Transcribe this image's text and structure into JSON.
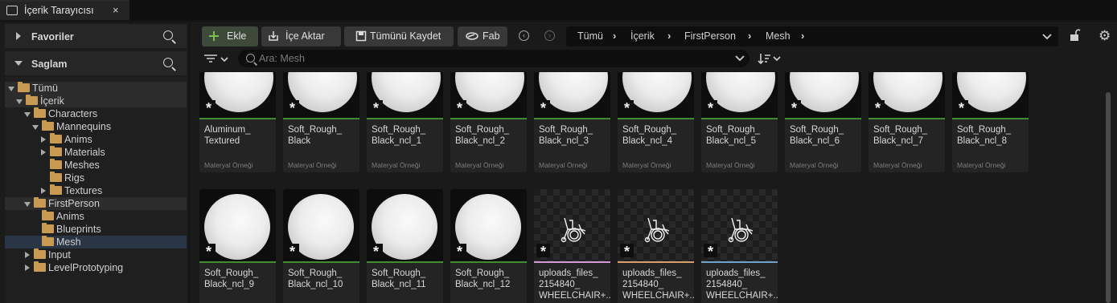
{
  "tab": {
    "title": "İçerik Tarayıcısı",
    "close": "×"
  },
  "left": {
    "favorites": "Favoriler",
    "source": "Saglam",
    "tree": [
      {
        "label": "Tümü",
        "depth": 0,
        "arrow": "open",
        "state": "hl"
      },
      {
        "label": "İçerik",
        "depth": 1,
        "arrow": "open",
        "state": "hl"
      },
      {
        "label": "Characters",
        "depth": 2,
        "arrow": "open",
        "state": ""
      },
      {
        "label": "Mannequins",
        "depth": 3,
        "arrow": "open",
        "state": ""
      },
      {
        "label": "Anims",
        "depth": 4,
        "arrow": "closed",
        "state": ""
      },
      {
        "label": "Materials",
        "depth": 4,
        "arrow": "closed",
        "state": ""
      },
      {
        "label": "Meshes",
        "depth": 4,
        "arrow": "none",
        "state": ""
      },
      {
        "label": "Rigs",
        "depth": 4,
        "arrow": "none",
        "state": ""
      },
      {
        "label": "Textures",
        "depth": 4,
        "arrow": "closed",
        "state": ""
      },
      {
        "label": "FirstPerson",
        "depth": 2,
        "arrow": "open",
        "state": "hl"
      },
      {
        "label": "Anims",
        "depth": 3,
        "arrow": "none",
        "state": ""
      },
      {
        "label": "Blueprints",
        "depth": 3,
        "arrow": "none",
        "state": ""
      },
      {
        "label": "Mesh",
        "depth": 3,
        "arrow": "none",
        "state": "sel"
      },
      {
        "label": "Input",
        "depth": 2,
        "arrow": "closed",
        "state": ""
      },
      {
        "label": "LevelPrototyping",
        "depth": 2,
        "arrow": "closed",
        "state": ""
      }
    ]
  },
  "toolbar": {
    "add_label": "Ekle",
    "import_label": "İçe Aktar",
    "save_all_label": "Tümünü Kaydet",
    "fab_label": "Fab"
  },
  "breadcrumb": [
    "Tümü",
    "İçerik",
    "FirstPerson",
    "Mesh"
  ],
  "search": {
    "placeholder": "Ara: Mesh"
  },
  "assets": [
    {
      "name": "Aluminum_\nTextured",
      "type": "Materyal Örneği",
      "kind": "sphere",
      "color": "#3f8f2f"
    },
    {
      "name": "Soft_Rough_\nBlack",
      "type": "Materyal Örneği",
      "kind": "sphere",
      "color": "#3f8f2f"
    },
    {
      "name": "Soft_Rough_\nBlack_ncl_1",
      "type": "Materyal Örneği",
      "kind": "sphere",
      "color": "#3f8f2f"
    },
    {
      "name": "Soft_Rough_\nBlack_ncl_2",
      "type": "Materyal Örneği",
      "kind": "sphere",
      "color": "#3f8f2f"
    },
    {
      "name": "Soft_Rough_\nBlack_ncl_3",
      "type": "Materyal Örneği",
      "kind": "sphere",
      "color": "#3f8f2f"
    },
    {
      "name": "Soft_Rough_\nBlack_ncl_4",
      "type": "Materyal Örneği",
      "kind": "sphere",
      "color": "#3f8f2f"
    },
    {
      "name": "Soft_Rough_\nBlack_ncl_5",
      "type": "Materyal Örneği",
      "kind": "sphere",
      "color": "#3f8f2f"
    },
    {
      "name": "Soft_Rough_\nBlack_ncl_6",
      "type": "Materyal Örneği",
      "kind": "sphere",
      "color": "#3f8f2f"
    },
    {
      "name": "Soft_Rough_\nBlack_ncl_7",
      "type": "Materyal Örneği",
      "kind": "sphere",
      "color": "#3f8f2f"
    },
    {
      "name": "Soft_Rough_\nBlack_ncl_8",
      "type": "Materyal Örneği",
      "kind": "sphere",
      "color": "#3f8f2f"
    },
    {
      "name": "Soft_Rough_\nBlack_ncl_9",
      "type": "",
      "kind": "sphere",
      "color": "#3f8f2f"
    },
    {
      "name": "Soft_Rough_\nBlack_ncl_10",
      "type": "",
      "kind": "sphere",
      "color": "#3f8f2f"
    },
    {
      "name": "Soft_Rough_\nBlack_ncl_11",
      "type": "",
      "kind": "sphere",
      "color": "#3f8f2f"
    },
    {
      "name": "Soft_Rough_\nBlack_ncl_12",
      "type": "",
      "kind": "sphere",
      "color": "#3f8f2f"
    },
    {
      "name": "uploads_files_\n2154840_\nWHEELCHAIR+...",
      "type": "",
      "kind": "wheelchair",
      "color": "#d59ad8"
    },
    {
      "name": "uploads_files_\n2154840_\nWHEELCHAIR+...",
      "type": "",
      "kind": "wheelchair",
      "color": "#d9a06a"
    },
    {
      "name": "uploads_files_\n2154840_\nWHEELCHAIR+...",
      "type": "",
      "kind": "wheelchair",
      "color": "#6fa3c9"
    }
  ]
}
